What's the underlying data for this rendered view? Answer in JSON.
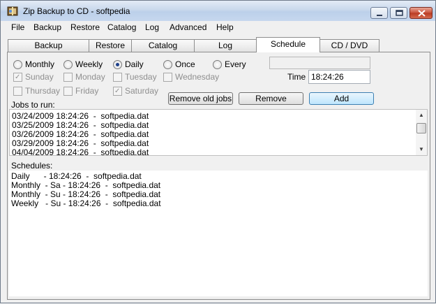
{
  "window": {
    "title": "Zip Backup to CD - softpedia",
    "watermark": "SOFTPEDIA"
  },
  "menu": {
    "items": [
      {
        "label": "File"
      },
      {
        "label": "Backup"
      },
      {
        "label": "Restore"
      },
      {
        "label": "Catalog"
      },
      {
        "label": "Log"
      },
      {
        "label": "Advanced"
      },
      {
        "label": "Help"
      }
    ]
  },
  "tabs": [
    {
      "label": "Backup"
    },
    {
      "label": "Restore"
    },
    {
      "label": "Catalog"
    },
    {
      "label": "Log"
    },
    {
      "label": "Schedule"
    },
    {
      "label": "CD / DVD"
    }
  ],
  "frequency": {
    "monthly": "Monthly",
    "weekly": "Weekly",
    "daily": "Daily",
    "once": "Once",
    "every": "Every",
    "selected": "Daily"
  },
  "days": {
    "sunday": "Sunday",
    "monday": "Monday",
    "tuesday": "Tuesday",
    "wednesday": "Wednesday",
    "thursday": "Thursday",
    "friday": "Friday",
    "saturday": "Saturday",
    "checked": [
      "Sunday",
      "Saturday"
    ]
  },
  "time": {
    "label": "Time",
    "value": "18:24:26"
  },
  "every_value": "",
  "buttons": {
    "remove_old": "Remove old jobs",
    "remove": "Remove",
    "add": "Add"
  },
  "jobs": {
    "label": "Jobs to run:",
    "rows": [
      "03/24/2009 18:24:26  -  softpedia.dat",
      "03/25/2009 18:24:26  -  softpedia.dat",
      "03/26/2009 18:24:26  -  softpedia.dat",
      "03/29/2009 18:24:26  -  softpedia.dat",
      "04/04/2009 18:24:26  -  softpedia.dat"
    ]
  },
  "schedules": {
    "label": "Schedules:",
    "rows": [
      "Daily      - 18:24:26  -  softpedia.dat",
      "Monthly  - Sa - 18:24:26  -  softpedia.dat",
      "Monthly  - Su - 18:24:26  -  softpedia.dat",
      "Weekly   - Su - 18:24:26  -  softpedia.dat"
    ]
  },
  "colors": {
    "accent": "#1d3f8a",
    "titlebar": "#c9d8ec",
    "close": "#c9513a"
  }
}
